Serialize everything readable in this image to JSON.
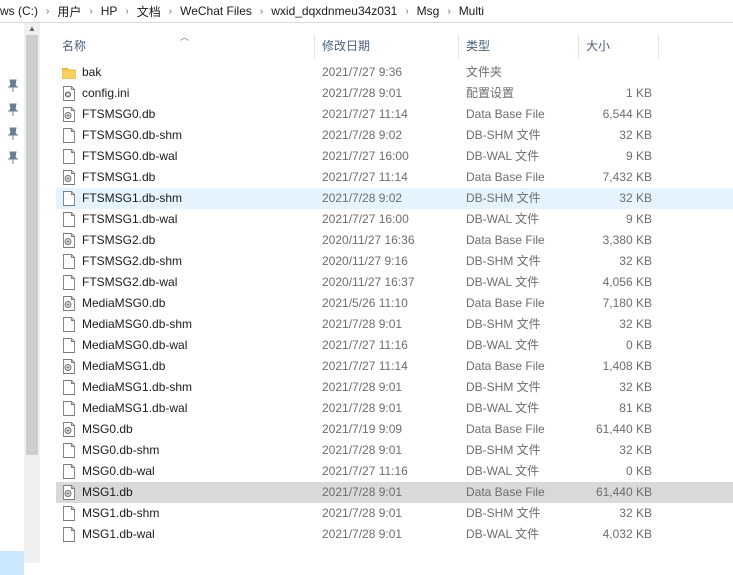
{
  "breadcrumb": [
    "ws (C:)",
    "用户",
    "HP",
    "文档",
    "WeChat Files",
    "wxid_dqxdnmeu34z031",
    "Msg",
    "Multi"
  ],
  "columns": {
    "name": "名称",
    "date": "修改日期",
    "type": "类型",
    "size": "大小"
  },
  "files": [
    {
      "name": "bak",
      "date": "2021/7/27 9:36",
      "type": "文件夹",
      "size": "",
      "icon": "folder-icon"
    },
    {
      "name": "config.ini",
      "date": "2021/7/28 9:01",
      "type": "配置设置",
      "size": "1 KB",
      "icon": "config-file-icon"
    },
    {
      "name": "FTSMSG0.db",
      "date": "2021/7/27 11:14",
      "type": "Data Base File",
      "size": "6,544 KB",
      "icon": "database-file-icon"
    },
    {
      "name": "FTSMSG0.db-shm",
      "date": "2021/7/28 9:02",
      "type": "DB-SHM 文件",
      "size": "32 KB",
      "icon": "file-icon"
    },
    {
      "name": "FTSMSG0.db-wal",
      "date": "2021/7/27 16:00",
      "type": "DB-WAL 文件",
      "size": "9 KB",
      "icon": "file-icon"
    },
    {
      "name": "FTSMSG1.db",
      "date": "2021/7/27 11:14",
      "type": "Data Base File",
      "size": "7,432 KB",
      "icon": "database-file-icon"
    },
    {
      "name": "FTSMSG1.db-shm",
      "date": "2021/7/28 9:02",
      "type": "DB-SHM 文件",
      "size": "32 KB",
      "icon": "file-icon",
      "state": "hover"
    },
    {
      "name": "FTSMSG1.db-wal",
      "date": "2021/7/27 16:00",
      "type": "DB-WAL 文件",
      "size": "9 KB",
      "icon": "file-icon"
    },
    {
      "name": "FTSMSG2.db",
      "date": "2020/11/27 16:36",
      "type": "Data Base File",
      "size": "3,380 KB",
      "icon": "database-file-icon"
    },
    {
      "name": "FTSMSG2.db-shm",
      "date": "2020/11/27 9:16",
      "type": "DB-SHM 文件",
      "size": "32 KB",
      "icon": "file-icon"
    },
    {
      "name": "FTSMSG2.db-wal",
      "date": "2020/11/27 16:37",
      "type": "DB-WAL 文件",
      "size": "4,056 KB",
      "icon": "file-icon"
    },
    {
      "name": "MediaMSG0.db",
      "date": "2021/5/26 11:10",
      "type": "Data Base File",
      "size": "7,180 KB",
      "icon": "database-file-icon"
    },
    {
      "name": "MediaMSG0.db-shm",
      "date": "2021/7/28 9:01",
      "type": "DB-SHM 文件",
      "size": "32 KB",
      "icon": "file-icon"
    },
    {
      "name": "MediaMSG0.db-wal",
      "date": "2021/7/27 11:16",
      "type": "DB-WAL 文件",
      "size": "0 KB",
      "icon": "file-icon"
    },
    {
      "name": "MediaMSG1.db",
      "date": "2021/7/27 11:14",
      "type": "Data Base File",
      "size": "1,408 KB",
      "icon": "database-file-icon"
    },
    {
      "name": "MediaMSG1.db-shm",
      "date": "2021/7/28 9:01",
      "type": "DB-SHM 文件",
      "size": "32 KB",
      "icon": "file-icon"
    },
    {
      "name": "MediaMSG1.db-wal",
      "date": "2021/7/28 9:01",
      "type": "DB-WAL 文件",
      "size": "81 KB",
      "icon": "file-icon"
    },
    {
      "name": "MSG0.db",
      "date": "2021/7/19 9:09",
      "type": "Data Base File",
      "size": "61,440 KB",
      "icon": "database-file-icon"
    },
    {
      "name": "MSG0.db-shm",
      "date": "2021/7/28 9:01",
      "type": "DB-SHM 文件",
      "size": "32 KB",
      "icon": "file-icon"
    },
    {
      "name": "MSG0.db-wal",
      "date": "2021/7/27 11:16",
      "type": "DB-WAL 文件",
      "size": "0 KB",
      "icon": "file-icon"
    },
    {
      "name": "MSG1.db",
      "date": "2021/7/28 9:01",
      "type": "Data Base File",
      "size": "61,440 KB",
      "icon": "database-file-icon",
      "state": "selected"
    },
    {
      "name": "MSG1.db-shm",
      "date": "2021/7/28 9:01",
      "type": "DB-SHM 文件",
      "size": "32 KB",
      "icon": "file-icon"
    },
    {
      "name": "MSG1.db-wal",
      "date": "2021/7/28 9:01",
      "type": "DB-WAL 文件",
      "size": "4,032 KB",
      "icon": "file-icon"
    }
  ],
  "colors": {
    "hover_row": "#e5f3ff",
    "selected_row": "#d9d9d9",
    "header_text": "#4c607a",
    "folder": "#f5c244"
  }
}
